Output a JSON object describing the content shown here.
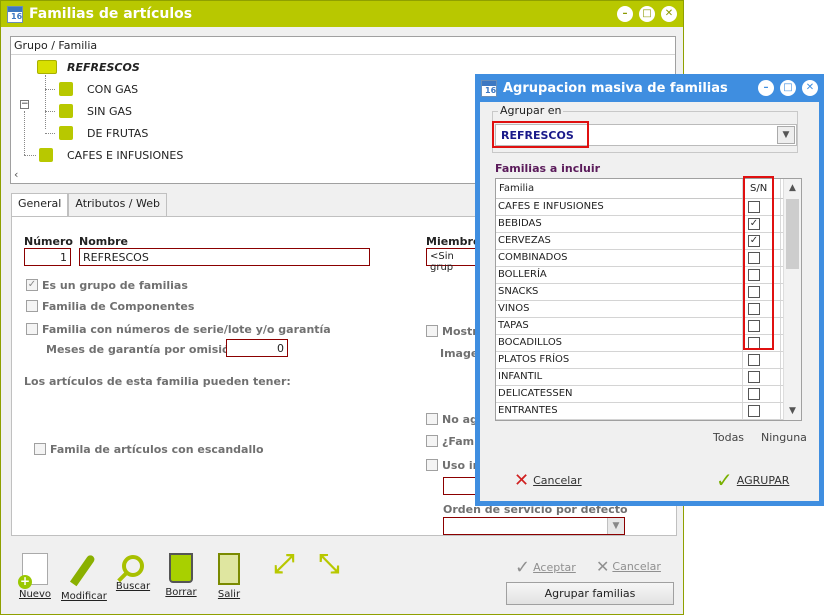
{
  "main_window": {
    "title": "Familias de artículos",
    "icon_text": "16",
    "tree": {
      "header": "Grupo / Familia",
      "items": [
        {
          "label": "REFRESCOS"
        },
        {
          "label": "CON GAS"
        },
        {
          "label": "SIN GAS"
        },
        {
          "label": "DE FRUTAS"
        },
        {
          "label": "CAFES E INFUSIONES"
        }
      ]
    },
    "tabs": [
      {
        "label": "General"
      },
      {
        "label": "Atributos / Web"
      }
    ],
    "form": {
      "numero_label": "Número",
      "numero_value": "1",
      "nombre_label": "Nombre",
      "nombre_value": "REFRESCOS",
      "miembro_label": "Miembro",
      "miembro_value": "<Sin grup",
      "es_grupo_label": "Es un grupo de familias",
      "familia_componentes_label": "Familia de Componentes",
      "familia_serie_label": "Familia con números de serie/lote y/o garantía",
      "meses_label": "Meses de garantía por omisión",
      "meses_value": "0",
      "articulos_label": "Los artículos de esta familia pueden tener:",
      "escandallo_label": "Famila de artículos con escandallo",
      "mostr_label": "Mostr",
      "image_label": "Image",
      "no_ag_label": "No ag",
      "fami_label": "¿Fami",
      "uso_label": "Uso in",
      "orden_label": "Orden de servicio por defecto"
    },
    "toolbar": {
      "nuevo": "Nuevo",
      "modificar": "Modificar",
      "buscar": "Buscar",
      "borrar": "Borrar",
      "salir": "Salir",
      "aceptar": "Aceptar",
      "cancelar": "Cancelar",
      "agrupar_familias": "Agrupar familias"
    }
  },
  "dialog": {
    "title": "Agrupacion masiva de familias",
    "icon_text": "16",
    "agrupar_en_label": "Agrupar en",
    "agrupar_en_value": "REFRESCOS",
    "familias_label": "Familias a incluir",
    "col_familia": "Familia",
    "col_sn": "S/N",
    "rows": [
      {
        "name": "CAFES E INFUSIONES",
        "checked": false
      },
      {
        "name": "BEBIDAS",
        "checked": true
      },
      {
        "name": "CERVEZAS",
        "checked": true
      },
      {
        "name": "COMBINADOS",
        "checked": false
      },
      {
        "name": "BOLLERÍA",
        "checked": false
      },
      {
        "name": "SNACKS",
        "checked": false
      },
      {
        "name": "VINOS",
        "checked": false
      },
      {
        "name": "TAPAS",
        "checked": false
      },
      {
        "name": "BOCADILLOS",
        "checked": false
      },
      {
        "name": "PLATOS FRÍOS",
        "checked": false
      },
      {
        "name": "INFANTIL",
        "checked": false
      },
      {
        "name": "DELICATESSEN",
        "checked": false
      },
      {
        "name": "ENTRANTES",
        "checked": false
      }
    ],
    "todas": "Todas",
    "ninguna": "Ninguna",
    "cancelar": "Cancelar",
    "agrupar": "AGRUPAR"
  }
}
